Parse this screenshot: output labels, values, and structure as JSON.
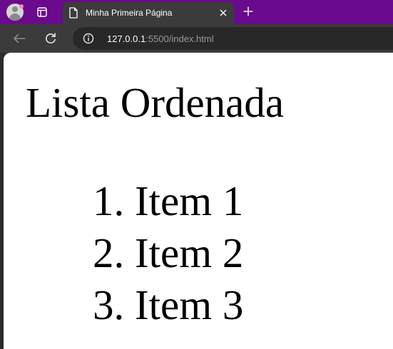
{
  "tab": {
    "title": "Minha Primeira Página"
  },
  "address_bar": {
    "host": "127.0.0.1",
    "path": ":5500/index.html"
  },
  "page": {
    "heading": "Lista Ordenada",
    "list_items": [
      {
        "marker": "1.",
        "text": "Item 1"
      },
      {
        "marker": "2.",
        "text": "Item 2"
      },
      {
        "marker": "3.",
        "text": "Item 3"
      }
    ]
  },
  "colors": {
    "tabstrip": "#6a0a8c",
    "toolbar": "#3b3b3b",
    "omnibox": "#282828",
    "page_background": "#ffffff"
  },
  "icons": {
    "profile": "profile-avatar-icon",
    "tab_actions": "tab-actions-icon",
    "page": "document-icon",
    "close": "close-icon",
    "new_tab": "plus-icon",
    "back": "arrow-left-icon",
    "reload": "reload-icon",
    "site_info": "info-icon"
  }
}
